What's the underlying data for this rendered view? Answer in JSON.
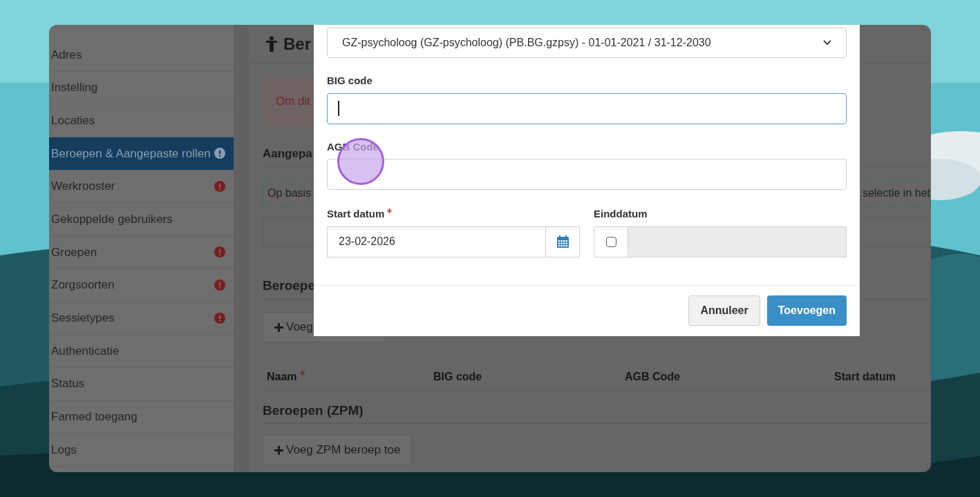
{
  "sidebar": {
    "items": [
      {
        "label": "Adres",
        "selected": false,
        "warning": false
      },
      {
        "label": "Instelling",
        "selected": false,
        "warning": false
      },
      {
        "label": "Locaties",
        "selected": false,
        "warning": false
      },
      {
        "label": "Beroepen & Aangepaste rollen",
        "selected": true,
        "warning": true
      },
      {
        "label": "Werkrooster",
        "selected": false,
        "warning": true
      },
      {
        "label": "Gekoppelde gebruikers",
        "selected": false,
        "warning": false
      },
      {
        "label": "Groepen",
        "selected": false,
        "warning": true
      },
      {
        "label": "Zorgsoorten",
        "selected": false,
        "warning": true
      },
      {
        "label": "Sessietypes",
        "selected": false,
        "warning": true
      },
      {
        "label": "Authenticatie",
        "selected": false,
        "warning": false
      },
      {
        "label": "Status",
        "selected": false,
        "warning": false
      },
      {
        "label": "Farmed toegang",
        "selected": false,
        "warning": false
      },
      {
        "label": "Logs",
        "selected": false,
        "warning": false
      }
    ]
  },
  "main": {
    "title": "Ber",
    "alert": "Om dit",
    "custom_roles_heading": "Aangepa",
    "info_left": "Op basis",
    "info_right": "selectie in het",
    "professions_heading": "Beroepe",
    "add_button": "Voeg",
    "table_columns": [
      {
        "label": "Naam",
        "required": true
      },
      {
        "label": "BIG code",
        "required": false
      },
      {
        "label": "AGB Code",
        "required": false
      },
      {
        "label": "Start datum",
        "required": false
      }
    ],
    "zpm_heading": "Beroepen (ZPM)",
    "zpm_button": "Voeg ZPM beroep toe"
  },
  "modal": {
    "profession_select": "GZ-psycholoog (GZ-psycholoog) (PB.BG.gzpsy) - 01-01-2021 / 31-12-2030",
    "fields": [
      {
        "label": "BIG code",
        "focused": true
      },
      {
        "label": "AGB Code",
        "focused": false
      }
    ],
    "start_date": {
      "label": "Start datum",
      "required": true,
      "value": "23-02-2026"
    },
    "end_date": {
      "label": "Einddatum",
      "checked": false
    },
    "buttons": [
      {
        "label": "Annuleer",
        "kind": "secondary"
      },
      {
        "label": "Toevoegen",
        "kind": "primary"
      }
    ]
  }
}
